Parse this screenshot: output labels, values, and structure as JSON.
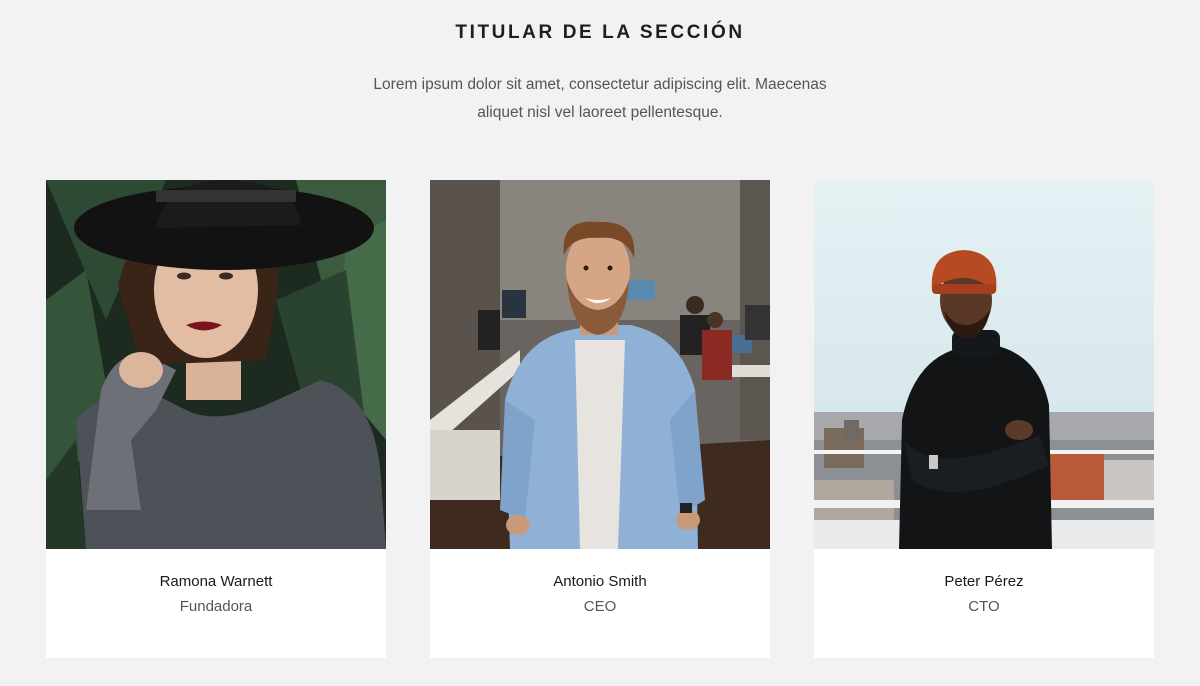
{
  "section": {
    "title": "TITULAR DE LA SECCIÓN",
    "description": "Lorem ipsum dolor sit amet, consectetur adipiscing elit. Maecenas aliquet nisl vel laoreet pellentesque."
  },
  "team": [
    {
      "name": "Ramona Warnett",
      "role": "Fundadora"
    },
    {
      "name": "Antonio Smith",
      "role": "CEO"
    },
    {
      "name": "Peter Pérez",
      "role": "CTO"
    }
  ],
  "colors": {
    "background": "#f2f2f2",
    "card": "#ffffff",
    "heading": "#1e1e1e",
    "body_text": "#555555"
  }
}
